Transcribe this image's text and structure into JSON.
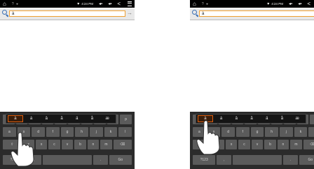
{
  "status_bar": {
    "time": "4:24 PM",
    "home_icon": "home-icon",
    "wifi_icon": "wifi-icon",
    "volume_icon": "volume-icon",
    "back_icon": "back-icon",
    "menu_icon": "menu-icon"
  },
  "search": {
    "value": "à",
    "icon": "search-icon",
    "go_icon": "arrow-right-icon"
  },
  "accent_popup": {
    "characters": [
      "à",
      "á",
      "â",
      "ã",
      "ä",
      "å",
      "æ"
    ],
    "highlight_color": "#e06010"
  },
  "keyboard": {
    "row1": [
      "q",
      "w",
      "e",
      "r",
      "t",
      "y",
      "u",
      "i",
      "o",
      "p"
    ],
    "row2": [
      "a",
      "s",
      "d",
      "f",
      "g",
      "h",
      "j",
      "k",
      "l"
    ],
    "row3": [
      "⇧",
      "z",
      "x",
      "c",
      "v",
      "b",
      "n",
      "m",
      "⌫"
    ],
    "row4": [
      "?123",
      ",",
      "",
      ".",
      "Go"
    ]
  }
}
